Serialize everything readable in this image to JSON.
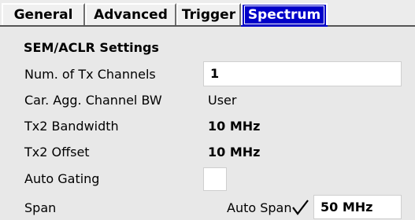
{
  "tabs": {
    "general": "General",
    "advanced": "Advanced",
    "trigger": "Trigger",
    "spectrum": "Spectrum",
    "active": "Spectrum"
  },
  "section_title": "SEM/ACLR Settings",
  "fields": {
    "num_tx_channels": {
      "label": "Num. of Tx Channels",
      "value": "1"
    },
    "car_agg_channel_bw": {
      "label": "Car. Agg. Channel BW",
      "value": "User"
    },
    "tx2_bandwidth": {
      "label": "Tx2 Bandwidth",
      "value": "10 MHz"
    },
    "tx2_offset": {
      "label": "Tx2 Offset",
      "value": "10 MHz"
    },
    "auto_gating": {
      "label": "Auto Gating",
      "checked": false
    },
    "span": {
      "label": "Span",
      "auto_label": "Auto Span",
      "auto_checked": true,
      "value": "50 MHz"
    }
  },
  "colors": {
    "active_tab_bg": "#0000c8",
    "background": "#e8e8e8",
    "field_bg": "#ffffff"
  },
  "icons": {
    "auto_span_check": "checkmark-icon"
  }
}
